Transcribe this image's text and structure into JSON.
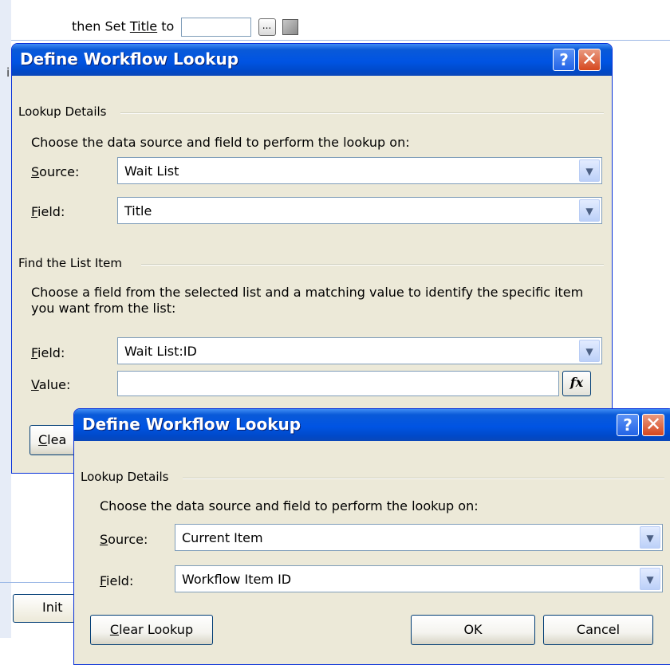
{
  "background": {
    "sentence_prefix": "then Set",
    "sentence_field": "Title",
    "sentence_to": "to",
    "ellipsis_button": "...",
    "stray_char": "i",
    "init_button_label": "Init"
  },
  "dialog_back": {
    "title": "Define Workflow Lookup",
    "help_label": "?",
    "close_label": "✕",
    "lookup_details": {
      "group_label": "Lookup Details",
      "instruction": "Choose the data source and field to perform the lookup on:",
      "source_label_u": "S",
      "source_label_rest": "ource:",
      "source_value": "Wait List",
      "field_label_u": "F",
      "field_label_rest": "ield:",
      "field_value": "Title"
    },
    "find_list_item": {
      "group_label": "Find the List Item",
      "instruction": "Choose a field from the selected list and a matching value to identify the specific item you want from the list:",
      "field_label_u": "F",
      "field_label_rest": "ield:",
      "field_value": "Wait List:ID",
      "value_label_u": "V",
      "value_label_rest": "alue:",
      "value_value": "",
      "fx_label": "fx"
    },
    "clear_button_u": "C",
    "clear_button_rest": "lea"
  },
  "dialog_front": {
    "title": "Define Workflow Lookup",
    "help_label": "?",
    "close_label": "✕",
    "group_label": "Lookup Details",
    "instruction": "Choose the data source and field to perform the lookup on:",
    "source_label_u": "S",
    "source_label_rest": "ource:",
    "source_value": "Current Item",
    "field_label_u": "F",
    "field_label_rest": "ield:",
    "field_value": "Workflow Item ID",
    "clear_lookup_u": "C",
    "clear_lookup_rest": "lear Lookup",
    "ok_label": "OK",
    "cancel_label": "Cancel"
  },
  "icons": {
    "combo_arrow": "chevron-down-icon",
    "builder": "builder-icon"
  }
}
